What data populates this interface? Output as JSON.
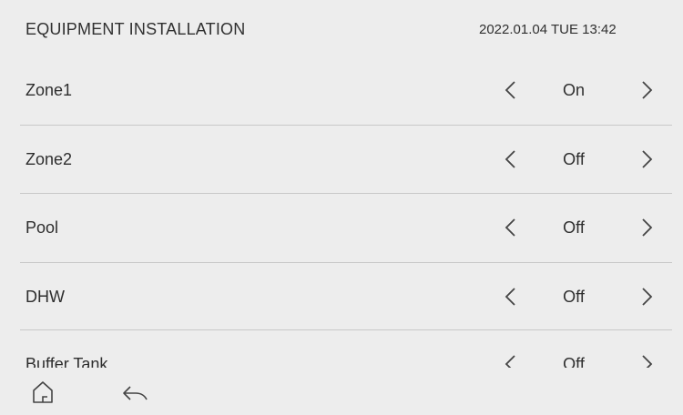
{
  "header": {
    "title": "EQUIPMENT INSTALLATION",
    "datetime": "2022.01.04 TUE 13:42"
  },
  "settings": [
    {
      "label": "Zone1",
      "value": "On"
    },
    {
      "label": "Zone2",
      "value": "Off"
    },
    {
      "label": "Pool",
      "value": "Off"
    },
    {
      "label": "DHW",
      "value": "Off"
    },
    {
      "label": "Buffer Tank",
      "value": "Off"
    }
  ],
  "icons": {
    "previous": "chevron-left-icon",
    "next": "chevron-right-icon",
    "home": "home-icon",
    "back": "back-arrow-icon"
  },
  "colors": {
    "background": "#ededed",
    "text": "#2e2e2e",
    "divider": "#c9c9c9",
    "icon": "#444444"
  }
}
